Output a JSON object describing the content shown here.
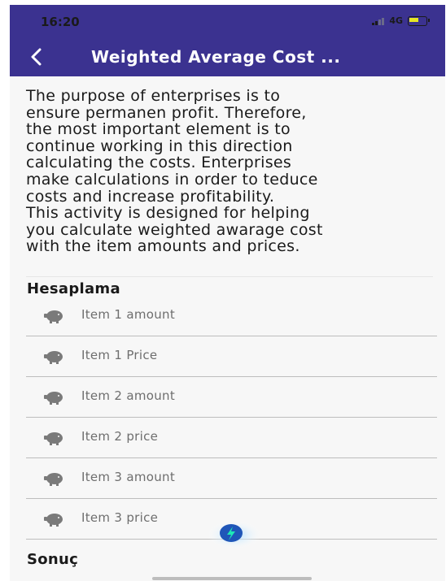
{
  "status_bar": {
    "time": "16:20",
    "network": "4G"
  },
  "app_bar": {
    "title": "Weighted Average Cost ...",
    "back_icon": "chevron-left-icon",
    "color": "#3b3290"
  },
  "description": "The purpose of enterprises is to\nensure permanen profit. Therefore,\nthe most important element is to\ncontinue working in this direction\ncalculating the costs. Enterprises\nmake calculations in order to teduce\ncosts and increase profitability.\nThis activity is designed for helping\nyou calculate weighted awarage cost\nwith the item amounts and prices.",
  "calc_section": {
    "title": "Hesaplama",
    "fields": [
      {
        "label": "Item 1 amount",
        "icon": "piggy-bank-icon"
      },
      {
        "label": "Item 1 Price",
        "icon": "piggy-bank-icon"
      },
      {
        "label": "Item 2 amount",
        "icon": "piggy-bank-icon"
      },
      {
        "label": "Item 2 price",
        "icon": "piggy-bank-icon"
      },
      {
        "label": "Item 3 amount",
        "icon": "piggy-bank-icon"
      },
      {
        "label": "Item 3 price",
        "icon": "piggy-bank-icon"
      }
    ]
  },
  "result_section": {
    "title": "Sonuç"
  },
  "fab": {
    "icon": "lightning-icon"
  }
}
